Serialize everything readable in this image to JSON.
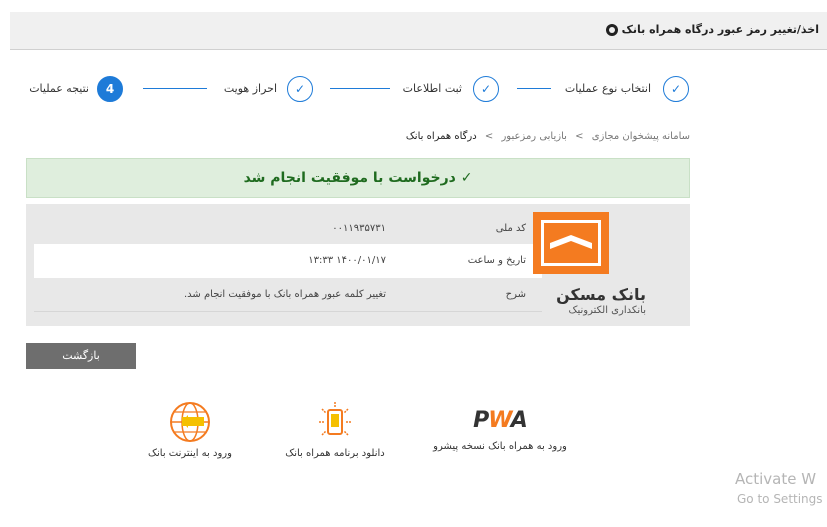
{
  "header": {
    "title": "اخذ/تغییر رمز عبور درگاه همراه بانک"
  },
  "stepper": {
    "steps": [
      {
        "label": "انتخاب نوع عملیات",
        "state": "done"
      },
      {
        "label": "ثبت اطلاعات",
        "state": "done"
      },
      {
        "label": "احراز هویت",
        "state": "done"
      },
      {
        "label": "نتیجه عملیات",
        "state": "active",
        "number": "4"
      }
    ],
    "check": "✓"
  },
  "breadcrumb": {
    "items": [
      "سامانه پیشخوان مجازی",
      "بازیابی رمزعبور",
      "درگاه همراه بانک"
    ],
    "separator": ">"
  },
  "result": {
    "message": "درخواست با موفقیت انجام شد",
    "icon": "check-icon"
  },
  "details": {
    "rows": [
      {
        "label": "کد ملی",
        "value": "۰۰۱۱۹۳۵۷۳۱"
      },
      {
        "label": "تاریخ و ساعت",
        "value": "۱۴۰۰/۰۱/۱۷ ۱۳:۳۳"
      },
      {
        "label": "شرح",
        "value": "تغییر کلمه عبور همراه بانک با موفقیت انجام شد."
      }
    ]
  },
  "bank": {
    "name": "بانک مسکن",
    "subtitle": "بانکداری الکترونیک",
    "brand_color": "#f47b20"
  },
  "actions": {
    "back_label": "بازگشت"
  },
  "apps": [
    {
      "label": "ورود به اینترنت بانک",
      "icon": "globe-icon"
    },
    {
      "label": "دانلود برنامه همراه بانک",
      "icon": "mobile-app-icon"
    },
    {
      "label": "ورود به همراه بانک نسخه پیشرو",
      "icon": "pwa-logo"
    }
  ],
  "pwa_text": {
    "p": "P",
    "w": "W",
    "a": "A"
  },
  "watermark": {
    "line1": "Activate W",
    "line2": "Go to Settings"
  },
  "colors": {
    "accent": "#1e7bd8",
    "success_bg": "#dfeedd",
    "success_text": "#1f6b1f"
  }
}
